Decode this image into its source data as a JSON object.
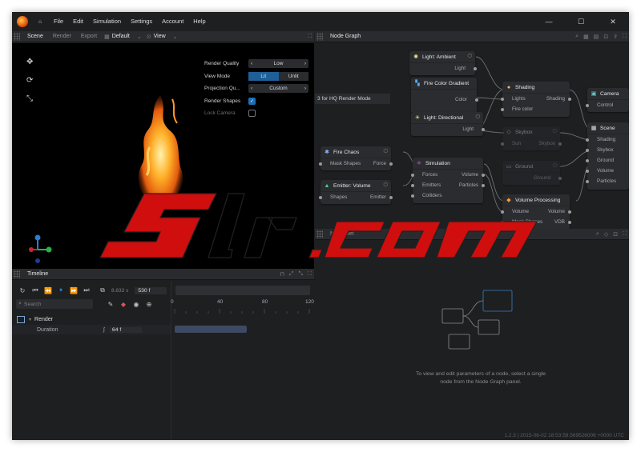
{
  "app": {
    "menu": [
      "File",
      "Edit",
      "Simulation",
      "Settings",
      "Account",
      "Help"
    ]
  },
  "viewport_panel": {
    "tabs": [
      "Scene",
      "Render",
      "Export"
    ],
    "camera": "Default",
    "view": "View"
  },
  "properties": {
    "render_quality": {
      "label": "Render Quality",
      "value": "Low"
    },
    "view_mode": {
      "label": "View Mode",
      "options": [
        "Lit",
        "Unlit"
      ],
      "selected": "Lit"
    },
    "projection": {
      "label": "Projection Qu...",
      "value": "Custom"
    },
    "render_shapes": {
      "label": "Render Shapes",
      "checked": true
    },
    "lock_camera": {
      "label": "Lock Camera",
      "checked": false
    }
  },
  "node_graph": {
    "title": "Node Graph",
    "banner": "3 for HQ Render Mode",
    "nodes": {
      "light_ambient": {
        "title": "Light: Ambient",
        "outputs": [
          "Light"
        ]
      },
      "color_gradient": {
        "title": "Fire Color Gradient",
        "outputs": [
          "Color"
        ]
      },
      "light_directional": {
        "title": "Light: Directional",
        "outputs": [
          "Light"
        ]
      },
      "shading": {
        "title": "Shading",
        "inputs": [
          "Lights",
          "Fire color"
        ],
        "outputs": [
          "Shading"
        ]
      },
      "skybox": {
        "title": "Skybox",
        "inputs": [
          "Sun"
        ],
        "outputs": [
          "Skybox"
        ]
      },
      "ground": {
        "title": "Ground",
        "outputs": [
          "Ground"
        ]
      },
      "camera": {
        "title": "Camera",
        "inputs": [
          "Control"
        ]
      },
      "scene": {
        "title": "Scene",
        "inputs": [
          "Shading",
          "Skybox",
          "Ground",
          "Volume",
          "Particles"
        ]
      },
      "fire_chaos": {
        "title": "Fire Chaos",
        "inputs": [
          "Mask Shapes"
        ],
        "outputs": [
          "Force"
        ]
      },
      "emitter_volume": {
        "title": "Emitter: Volume",
        "inputs": [
          "Shapes"
        ],
        "outputs": [
          "Emitter"
        ]
      },
      "simulation": {
        "title": "Simulation",
        "inputs": [
          "Forces",
          "Emitters",
          "Colliders"
        ],
        "outputs": [
          "Volume",
          "Particles"
        ]
      },
      "volume_processing": {
        "title": "Volume Processing",
        "inputs": [
          "Volume",
          "Mask Shapes"
        ],
        "outputs": [
          "Volume",
          "VDB"
        ]
      }
    }
  },
  "node_details": {
    "title": "Node Det",
    "empty_line1": "To view and edit parameters of a node, select a single",
    "empty_line2": "node from the Node Graph panel."
  },
  "timeline": {
    "title": "Timeline",
    "time": "8.833 s",
    "frame": "530 f",
    "search_placeholder": "Search",
    "ticks": [
      "0",
      "40",
      "80",
      "120"
    ],
    "track": {
      "name": "Render",
      "param": "Duration",
      "value": "64 f"
    }
  },
  "status": "1.2.3 | 2015-06-02 18:53:58.569526006 +0000 UTC",
  "watermark": "S1r.com",
  "colors": {
    "accent": "#1e6fb5",
    "bg": "#1e1f21"
  }
}
